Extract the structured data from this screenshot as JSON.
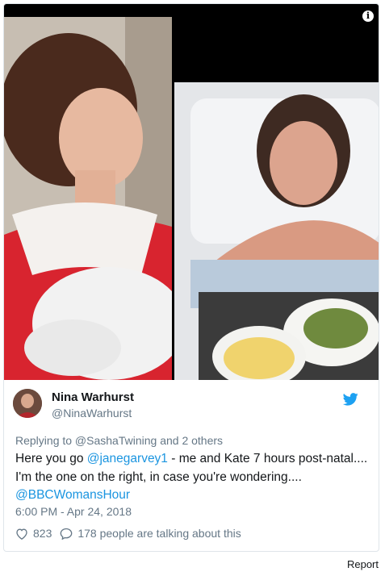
{
  "tweet": {
    "author_name": "Nina Warhurst",
    "author_handle": "@NinaWarhurst",
    "replying_to": "Replying to @SashaTwining and 2 others",
    "text_pre": "Here you go ",
    "mention_1": "@janegarvey1",
    "text_mid": " - me and Kate 7 hours post-natal.... I'm the one on the right, in case you're wondering....",
    "mention_2": "@BBCWomansHour",
    "timestamp": "6:00 PM - Apr 24, 2018",
    "likes": "823",
    "talking": "178 people are talking about this"
  },
  "report_label": "Report",
  "icons": {
    "info": "info-icon",
    "twitter": "twitter-bird-icon",
    "like": "heart-icon",
    "reply": "speech-bubble-icon"
  },
  "colors": {
    "link": "#1b95e0",
    "muted": "#657786",
    "text": "#14171a"
  }
}
